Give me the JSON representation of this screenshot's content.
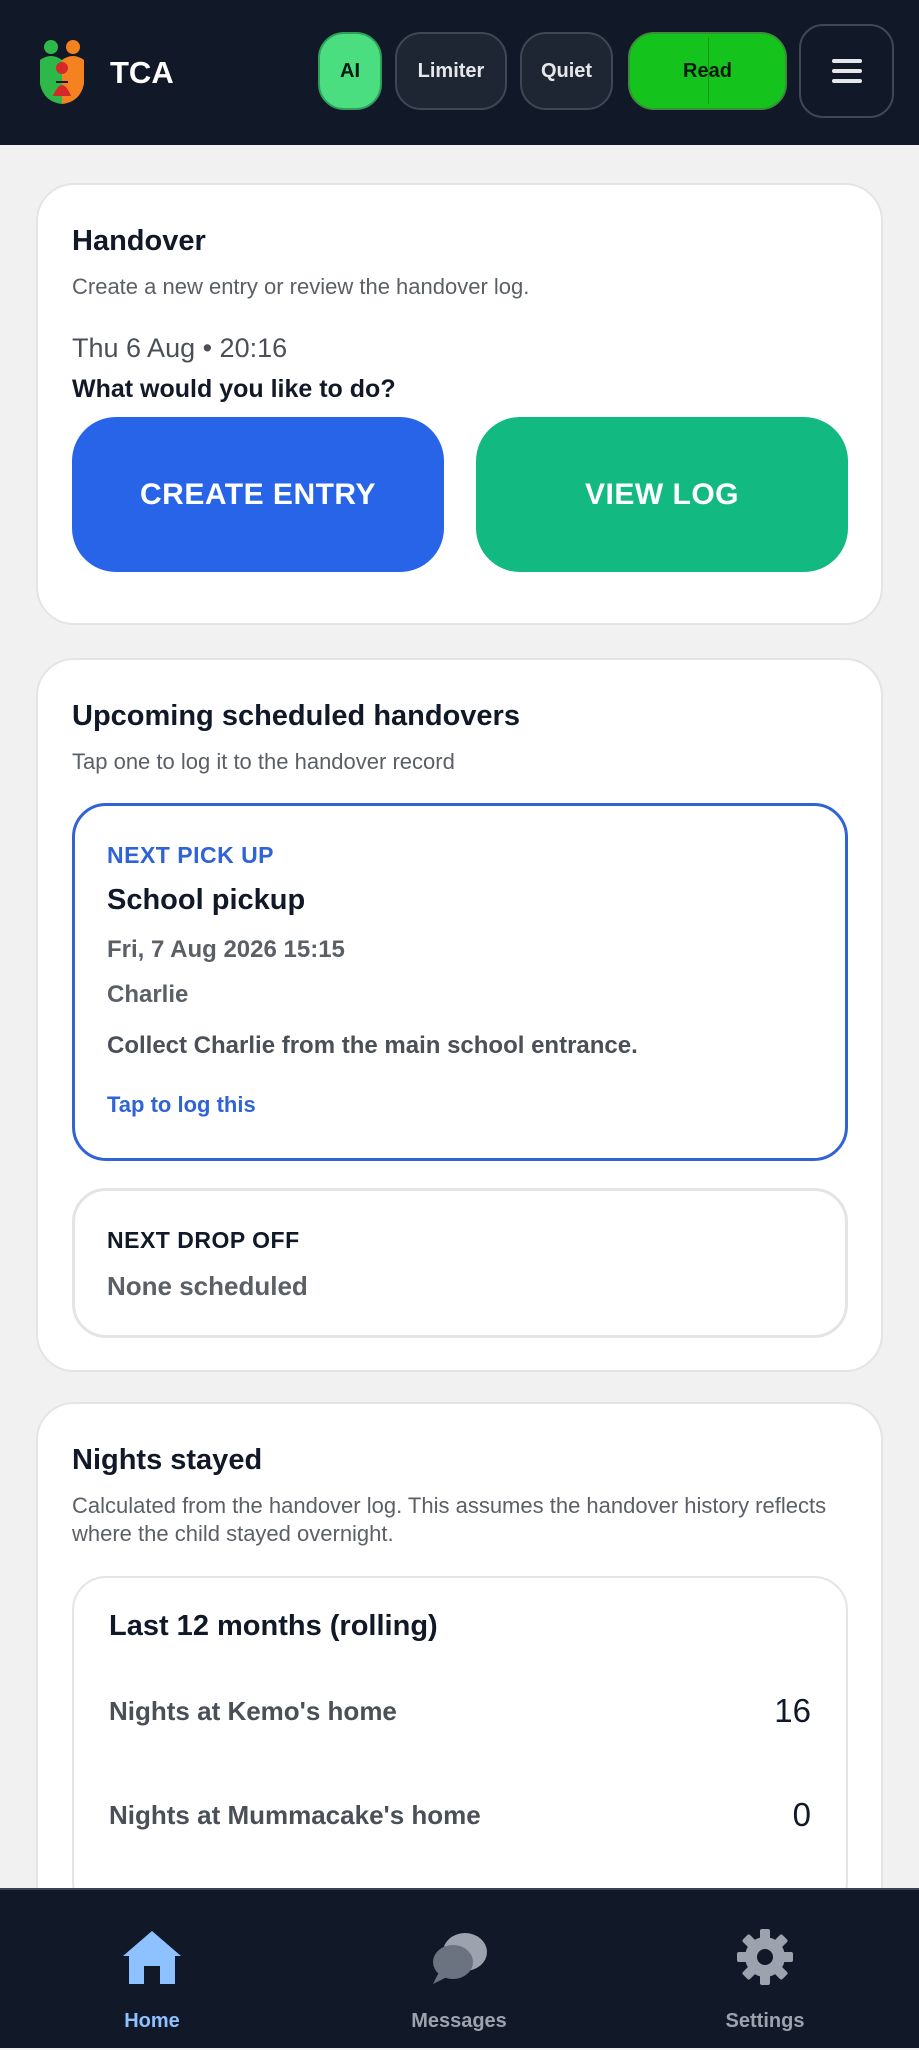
{
  "header": {
    "app_name": "TCA",
    "toggles": {
      "ai": "AI",
      "limiter": "Limiter",
      "quiet": "Quiet",
      "read": "Read"
    },
    "menu_icon": "hamburger-menu-icon",
    "logo_icon": "family-logo-icon"
  },
  "handover": {
    "title": "Handover",
    "subtitle": "Create a new entry or review the handover log.",
    "datetime": "Thu 6 Aug • 20:16",
    "prompt": "What would you like to do?",
    "create_label": "CREATE ENTRY",
    "view_label": "VIEW LOG"
  },
  "upcoming": {
    "title": "Upcoming scheduled handovers",
    "subtitle": "Tap one to log it to the handover record",
    "pickup": {
      "label": "NEXT PICK UP",
      "title": "School pickup",
      "datetime": "Fri, 7 Aug 2026 15:15",
      "child": "Charlie",
      "note": "Collect Charlie from the main school entrance.",
      "action": "Tap to log this"
    },
    "dropoff": {
      "label": "NEXT DROP OFF",
      "status": "None scheduled"
    }
  },
  "nights": {
    "title": "Nights stayed",
    "subtitle": "Calculated from the handover log. This assumes the handover history reflects where the child stayed overnight.",
    "period_title": "Last 12 months (rolling)",
    "rows": [
      {
        "label": "Nights at Kemo's home",
        "value": "16"
      },
      {
        "label": "Nights at Mummacake's home",
        "value": "0"
      }
    ]
  },
  "nav": {
    "items": [
      {
        "label": "Home",
        "icon": "home-icon",
        "active": true
      },
      {
        "label": "Messages",
        "icon": "chat-bubbles-icon",
        "active": false
      },
      {
        "label": "Settings",
        "icon": "gear-icon",
        "active": false
      }
    ]
  },
  "colors": {
    "header_bg": "#111827",
    "create_blue": "#2764e8",
    "view_green": "#12b981",
    "ai_green": "#4ade80",
    "read_green": "#15c31d",
    "accent_blue": "#2f63d6"
  }
}
